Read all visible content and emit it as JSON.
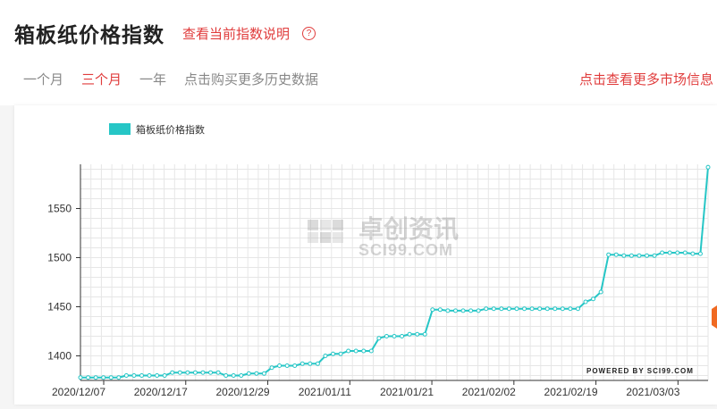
{
  "header": {
    "title": "箱板纸价格指数",
    "explain_link": "查看当前指数说明",
    "help_icon": "question-circle-icon"
  },
  "range_tabs": [
    {
      "label": "一个月",
      "active": false
    },
    {
      "label": "三个月",
      "active": true
    },
    {
      "label": "一年",
      "active": false
    },
    {
      "label": "点击购买更多历史数据",
      "active": false
    }
  ],
  "more_market_link": "点击查看更多市场信息",
  "watermark": {
    "cn": "卓创资讯",
    "en": "SCI99.COM",
    "powered": "POWERED BY SCI99.COM"
  },
  "chart_data": {
    "type": "line",
    "series": [
      {
        "name": "箱板纸价格指数",
        "color": "#26c6c6",
        "values": [
          1378,
          1378,
          1378,
          1378,
          1378,
          1378,
          1380,
          1380,
          1380,
          1380,
          1380,
          1380,
          1383,
          1383,
          1383,
          1383,
          1383,
          1383,
          1383,
          1380,
          1380,
          1380,
          1382,
          1382,
          1382,
          1388,
          1390,
          1390,
          1390,
          1392,
          1392,
          1392,
          1400,
          1402,
          1402,
          1405,
          1405,
          1405,
          1405,
          1418,
          1420,
          1420,
          1420,
          1422,
          1422,
          1422,
          1447,
          1447,
          1446,
          1446,
          1446,
          1446,
          1446,
          1448,
          1448,
          1448,
          1448,
          1448,
          1448,
          1448,
          1448,
          1448,
          1448,
          1448,
          1448,
          1448,
          1455,
          1458,
          1465,
          1503,
          1503,
          1502,
          1502,
          1502,
          1502,
          1502,
          1505,
          1505,
          1505,
          1505,
          1504,
          1504,
          1592
        ]
      }
    ],
    "x_tick_labels": [
      "2020/12/07",
      "2020/12/17",
      "2020/12/29",
      "2021/01/11",
      "2021/01/21",
      "2021/02/02",
      "2021/02/19",
      "2021/03/03"
    ],
    "y_ticks": [
      1400,
      1450,
      1500,
      1550
    ],
    "ylim": [
      1375,
      1595
    ],
    "grid": true,
    "legend_position": "top-left"
  }
}
